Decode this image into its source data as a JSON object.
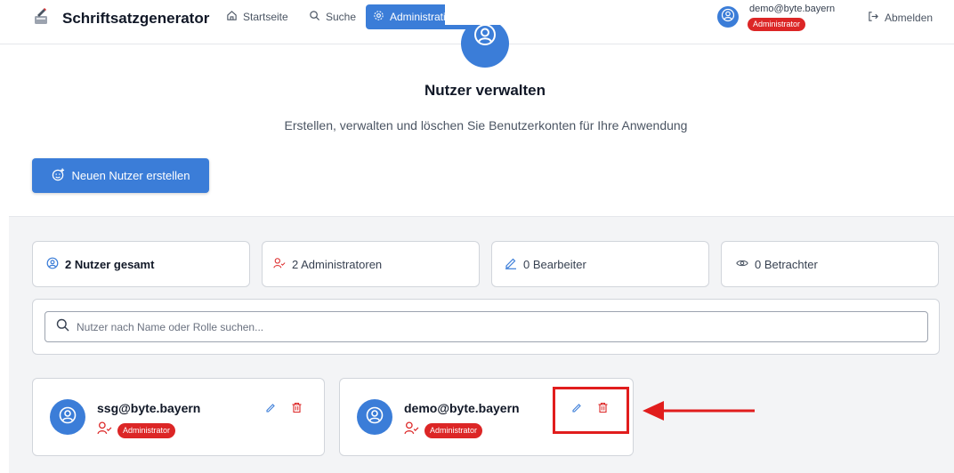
{
  "header": {
    "app_title": "Schriftsatzgenerator",
    "nav": [
      {
        "label": "Startseite",
        "icon": "home-icon"
      },
      {
        "label": "Suche",
        "icon": "search-icon"
      },
      {
        "label": "Administration",
        "icon": "gear-icon",
        "active": true
      }
    ],
    "user": {
      "email": "demo@byte.bayern",
      "role": "Administrator"
    },
    "logout_label": "Abmelden"
  },
  "hero": {
    "title": "Nutzer verwalten",
    "subtitle": "Erstellen, verwalten und löschen Sie Benutzerkonten für Ihre Anwendung",
    "create_button": "Neuen Nutzer erstellen"
  },
  "stats": [
    {
      "label": "2 Nutzer gesamt",
      "icon": "users-icon"
    },
    {
      "label": "2 Administratoren",
      "icon": "user-check-icon"
    },
    {
      "label": "0 Bearbeiter",
      "icon": "pencil-icon"
    },
    {
      "label": "0 Betrachter",
      "icon": "eye-icon"
    }
  ],
  "search": {
    "placeholder": "Nutzer nach Name oder Rolle suchen...",
    "value": ""
  },
  "users": [
    {
      "email": "ssg@byte.bayern",
      "role": "Administrator"
    },
    {
      "email": "demo@byte.bayern",
      "role": "Administrator"
    }
  ],
  "colors": {
    "primary": "#3b7dd8",
    "danger": "#dc2626",
    "annotation": "#e11d1d",
    "section_bg": "#f3f4f6"
  }
}
